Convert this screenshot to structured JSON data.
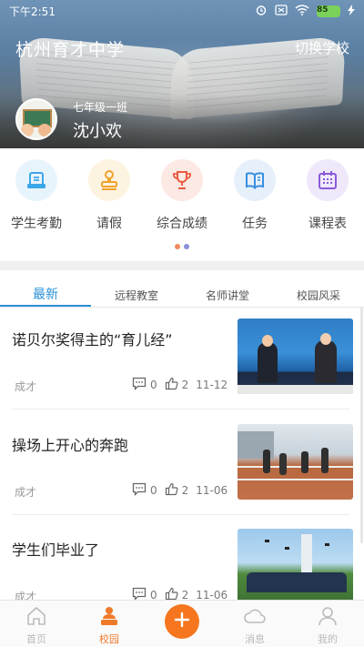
{
  "status_bar": {
    "time": "下午2:51",
    "battery": "85"
  },
  "header": {
    "school_name": "杭州育才中学",
    "switch_label": "切换学校",
    "class_name": "七年级一班",
    "student_name": "沈小欢"
  },
  "quick_menu": [
    {
      "label": "学生考勤",
      "icon": "attendance-icon",
      "color": "#3ba6e8",
      "bg": "#e8f4fc"
    },
    {
      "label": "请假",
      "icon": "stamp-icon",
      "color": "#f0a32c",
      "bg": "#fdf3e1"
    },
    {
      "label": "综合成绩",
      "icon": "trophy-icon",
      "color": "#ea5b3f",
      "bg": "#fce9e4"
    },
    {
      "label": "任务",
      "icon": "book-icon",
      "color": "#3a8fe0",
      "bg": "#e6f0fb"
    },
    {
      "label": "课程表",
      "icon": "calendar-icon",
      "color": "#8a5ad8",
      "bg": "#efe8fb"
    }
  ],
  "pager": {
    "active_color": "#f08a5d",
    "inactive_color": "#8a8fd8"
  },
  "tabs": [
    "最新",
    "远程教室",
    "名师讲堂",
    "校园风采"
  ],
  "news": [
    {
      "title": "诺贝尔奖得主的“育儿经”",
      "source": "成才",
      "comments": "0",
      "likes": "2",
      "date": "11-12"
    },
    {
      "title": "操场上开心的奔跑",
      "source": "成才",
      "comments": "0",
      "likes": "2",
      "date": "11-06"
    },
    {
      "title": "学生们毕业了",
      "source": "成才",
      "comments": "0",
      "likes": "2",
      "date": "11-06"
    }
  ],
  "bottom_nav": {
    "home": "首页",
    "campus": "校园",
    "messages": "消息",
    "mine": "我的"
  },
  "colors": {
    "accent": "#2a8fd6",
    "orange": "#f5761f"
  }
}
